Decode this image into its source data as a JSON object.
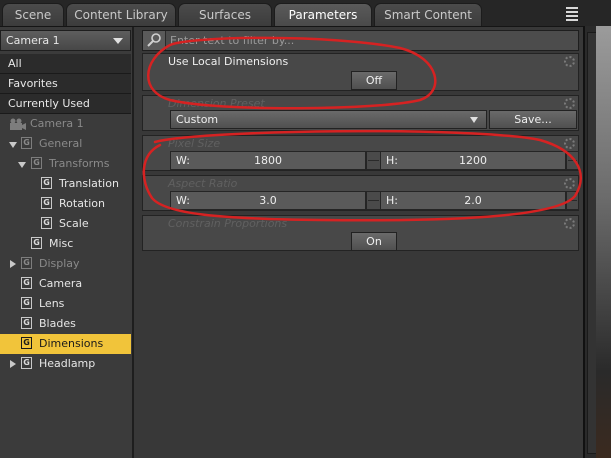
{
  "tabs": [
    {
      "label": "Scene"
    },
    {
      "label": "Content Library"
    },
    {
      "label": "Surfaces"
    },
    {
      "label": "Parameters"
    },
    {
      "label": "Smart Content"
    }
  ],
  "node_select": {
    "value": "Camera 1"
  },
  "filters": [
    {
      "label": "All"
    },
    {
      "label": "Favorites"
    },
    {
      "label": "Currently Used"
    }
  ],
  "tree": [
    {
      "label": "Camera 1"
    },
    {
      "label": "General"
    },
    {
      "label": "Transforms"
    },
    {
      "label": "Translation"
    },
    {
      "label": "Rotation"
    },
    {
      "label": "Scale"
    },
    {
      "label": "Misc"
    },
    {
      "label": "Display"
    },
    {
      "label": "Camera"
    },
    {
      "label": "Lens"
    },
    {
      "label": "Blades"
    },
    {
      "label": "Dimensions"
    },
    {
      "label": "Headlamp"
    }
  ],
  "group_icon_glyph": "G",
  "search": {
    "placeholder": "Enter text to filter by..."
  },
  "params": {
    "local_dims": {
      "title": "Use Local Dimensions",
      "value": "Off"
    },
    "preset": {
      "title": "Dimension Preset",
      "value": "Custom",
      "save_label": "Save..."
    },
    "pixel_size": {
      "title": "Pixel Size",
      "w_label": "W:",
      "w_value": "1800",
      "h_label": "H:",
      "h_value": "1200"
    },
    "aspect": {
      "title": "Aspect Ratio",
      "w_label": "W:",
      "w_value": "3.0",
      "h_label": "H:",
      "h_value": "2.0"
    },
    "constrain": {
      "title": "Constrain Proportions",
      "value": "On"
    }
  },
  "colors": {
    "selected_row": "#f1c43a",
    "annotation_ink": "#d62222"
  }
}
